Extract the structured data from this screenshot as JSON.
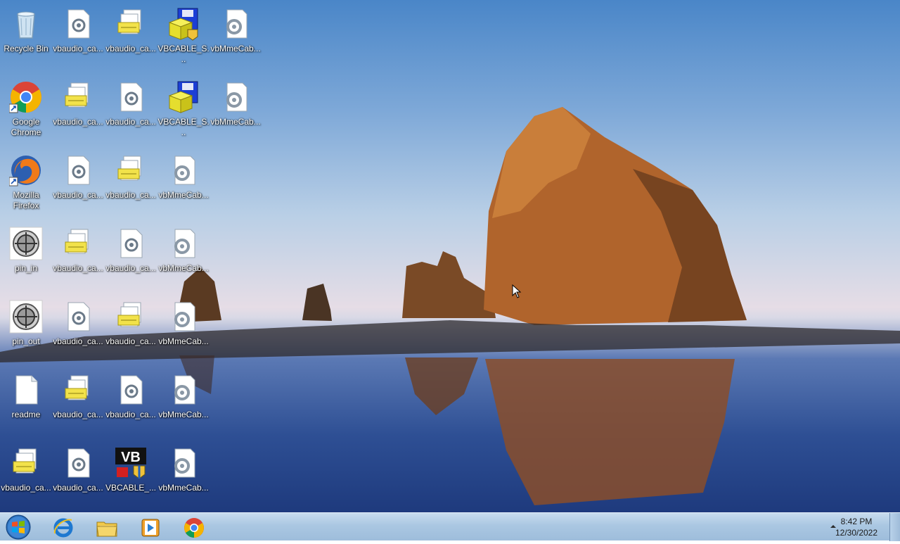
{
  "desktop": {
    "icons": [
      {
        "label": "Recycle Bin",
        "type": "recycle-bin"
      },
      {
        "label": "vbaudio_ca...",
        "type": "settings-file"
      },
      {
        "label": "vbaudio_ca...",
        "type": "setup-file"
      },
      {
        "label": "VBCABLE_S...",
        "type": "installer"
      },
      {
        "label": "vbMmeCab...",
        "type": "settings-file"
      },
      {
        "label": "Google Chrome",
        "type": "chrome"
      },
      {
        "label": "vbaudio_ca...",
        "type": "setup-file"
      },
      {
        "label": "vbaudio_ca...",
        "type": "settings-file"
      },
      {
        "label": "VBCABLE_S...",
        "type": "installer"
      },
      {
        "label": "vbMmeCab...",
        "type": "settings-file"
      },
      {
        "label": "Mozilla Firefox",
        "type": "firefox"
      },
      {
        "label": "vbaudio_ca...",
        "type": "settings-file"
      },
      {
        "label": "vbaudio_ca...",
        "type": "setup-file"
      },
      {
        "label": "vbMmeCab...",
        "type": "settings-file"
      },
      {
        "label": "pin_in",
        "type": "pin"
      },
      {
        "label": "vbaudio_ca...",
        "type": "setup-file"
      },
      {
        "label": "vbaudio_ca...",
        "type": "settings-file"
      },
      {
        "label": "vbMmeCab...",
        "type": "settings-file"
      },
      {
        "label": "pin_out",
        "type": "pin"
      },
      {
        "label": "vbaudio_ca...",
        "type": "settings-file"
      },
      {
        "label": "vbaudio_ca...",
        "type": "setup-file"
      },
      {
        "label": "vbMmeCab...",
        "type": "settings-file"
      },
      {
        "label": "readme",
        "type": "text-file"
      },
      {
        "label": "vbaudio_ca...",
        "type": "setup-file"
      },
      {
        "label": "vbaudio_ca...",
        "type": "settings-file"
      },
      {
        "label": "vbMmeCab...",
        "type": "settings-file"
      },
      {
        "label": "vbaudio_ca...",
        "type": "setup-file"
      },
      {
        "label": "vbaudio_ca...",
        "type": "settings-file"
      },
      {
        "label": "VBCABLE_...",
        "type": "vb-audio"
      },
      {
        "label": "vbMmeCab...",
        "type": "settings-file"
      }
    ]
  },
  "taskbar": {
    "pinned": [
      {
        "name": "internet-explorer",
        "icon": "ie-icon"
      },
      {
        "name": "file-explorer",
        "icon": "folder-icon"
      },
      {
        "name": "media-player",
        "icon": "media-player-icon"
      },
      {
        "name": "google-chrome",
        "icon": "chrome-icon"
      }
    ],
    "clock": {
      "time": "8:42 PM",
      "date": "12/30/2022"
    }
  }
}
